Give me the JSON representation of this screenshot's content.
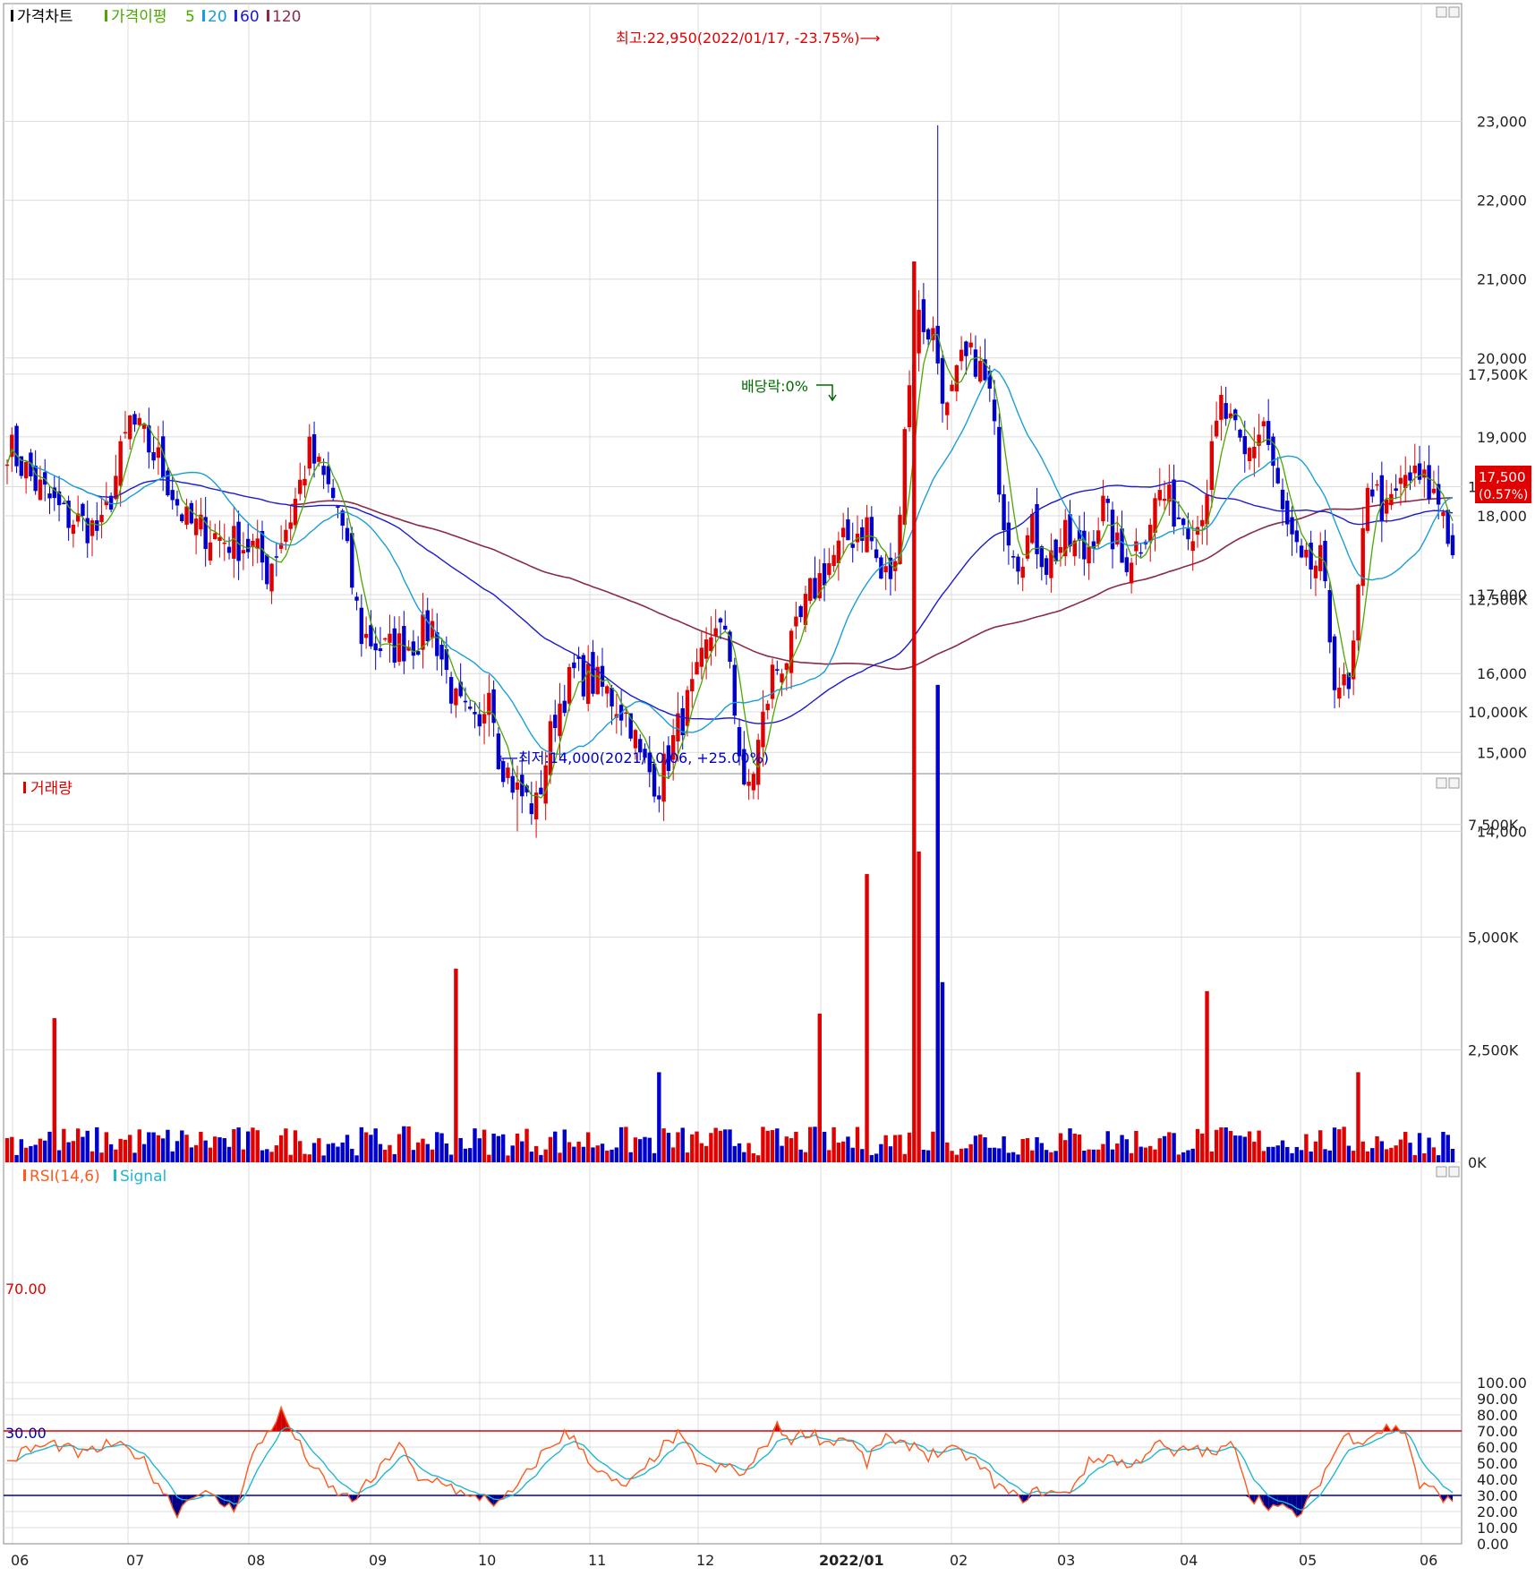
{
  "colors": {
    "up": "#e00000",
    "down": "#0000cc",
    "ma5": "#4aa800",
    "ma20": "#1a9ed8",
    "ma60": "#1a1ad0",
    "ma120": "#8a2a4a",
    "rsi": "#ff5a1e",
    "signal": "#20b8d0",
    "hi": "#e00000",
    "lo": "#00008a",
    "annot_red": "#e00000",
    "annot_blue": "#0000cc",
    "annot_green": "#006a00",
    "price_tag_bg": "#e00000"
  },
  "price_panel": {
    "legend": {
      "title": "가격차트",
      "ma_label": "가격이평",
      "ma5": "5",
      "ma20": "20",
      "ma60": "60",
      "ma120": "120"
    },
    "y_ticks": [
      "23,000",
      "22,000",
      "21,000",
      "20,000",
      "19,000",
      "18,000",
      "17,000",
      "16,000",
      "15,000",
      "14,000"
    ],
    "high_annotation": "최고:22,950(2022/01/17, -23.75%)⟶",
    "low_annotation": "⟵최저:14,000(2021/10/06, +25.00%)",
    "dividend_annotation": "배당락:0%",
    "current_price": "17,500",
    "current_change": "(0.57%)"
  },
  "volume_panel": {
    "legend": "거래량",
    "y_ticks": [
      "17,500K",
      "15,000K",
      "12,500K",
      "10,000K",
      "7,500K",
      "5,000K",
      "2,500K",
      "0K"
    ]
  },
  "rsi_panel": {
    "legend_rsi": "RSI(14,6)",
    "legend_signal": "Signal",
    "y_ticks": [
      "100.00",
      "90.00",
      "80.00",
      "70.00",
      "60.00",
      "50.00",
      "40.00",
      "30.00",
      "20.00",
      "10.00",
      "0.00"
    ],
    "level_high": "70.00",
    "level_low": "30.00"
  },
  "x_axis": {
    "labels": [
      "06",
      "07",
      "08",
      "09",
      "10",
      "11",
      "12",
      "2022/01",
      "02",
      "03",
      "04",
      "05",
      "06"
    ]
  },
  "chart_data": {
    "type": "candlestick",
    "period": "2021-06 to 2022-06 (daily)",
    "price_range": [
      13800,
      23300
    ],
    "high": {
      "value": 22950,
      "date": "2022/01/17",
      "pct": "-23.75%"
    },
    "low": {
      "value": 14000,
      "date": "2021/10/06",
      "pct": "+25.00%"
    },
    "last_close": 17500,
    "last_change_pct": 0.57,
    "close_anchors": [
      [
        0,
        18900
      ],
      [
        6,
        18400
      ],
      [
        12,
        18000
      ],
      [
        20,
        17800
      ],
      [
        26,
        19200
      ],
      [
        32,
        18700
      ],
      [
        38,
        17900
      ],
      [
        46,
        17700
      ],
      [
        52,
        17600
      ],
      [
        55,
        17300
      ],
      [
        60,
        18000
      ],
      [
        64,
        18800
      ],
      [
        70,
        18100
      ],
      [
        75,
        16500
      ],
      [
        80,
        16300
      ],
      [
        86,
        16400
      ],
      [
        90,
        16600
      ],
      [
        95,
        15600
      ],
      [
        100,
        15200
      ],
      [
        102,
        16000
      ],
      [
        104,
        15000
      ],
      [
        108,
        14500
      ],
      [
        112,
        14300
      ],
      [
        116,
        15500
      ],
      [
        120,
        16000
      ],
      [
        124,
        15900
      ],
      [
        128,
        15700
      ],
      [
        132,
        15400
      ],
      [
        134,
        14900
      ],
      [
        138,
        14600
      ],
      [
        142,
        15300
      ],
      [
        146,
        15900
      ],
      [
        150,
        16700
      ],
      [
        153,
        16200
      ],
      [
        156,
        14400
      ],
      [
        158,
        14800
      ],
      [
        162,
        16000
      ],
      [
        166,
        16300
      ],
      [
        170,
        17000
      ],
      [
        174,
        17400
      ],
      [
        178,
        17700
      ],
      [
        182,
        17900
      ],
      [
        185,
        17200
      ],
      [
        188,
        17300
      ],
      [
        190,
        19200
      ],
      [
        193,
        20500
      ],
      [
        196,
        20300
      ],
      [
        199,
        19300
      ],
      [
        202,
        19900
      ],
      [
        205,
        20000
      ],
      [
        208,
        19500
      ],
      [
        211,
        18000
      ],
      [
        214,
        17500
      ],
      [
        217,
        17800
      ],
      [
        220,
        17400
      ],
      [
        224,
        17700
      ],
      [
        228,
        17500
      ],
      [
        232,
        18100
      ],
      [
        236,
        17400
      ],
      [
        240,
        17700
      ],
      [
        244,
        18300
      ],
      [
        248,
        18000
      ],
      [
        252,
        17900
      ],
      [
        254,
        18400
      ],
      [
        257,
        19400
      ],
      [
        262,
        18700
      ],
      [
        266,
        19200
      ],
      [
        270,
        18000
      ],
      [
        274,
        17300
      ],
      [
        278,
        17400
      ],
      [
        281,
        16000
      ],
      [
        284,
        15700
      ],
      [
        286,
        16900
      ],
      [
        288,
        18500
      ],
      [
        292,
        18000
      ],
      [
        296,
        18500
      ],
      [
        300,
        18400
      ],
      [
        304,
        18100
      ],
      [
        306,
        17500
      ]
    ],
    "volume_ticks_k": [
      0,
      2500,
      5000,
      7500,
      10000,
      12500,
      15000,
      17500
    ],
    "volume_spikes": [
      {
        "i": 10,
        "v": 3200
      },
      {
        "i": 95,
        "v": 4300
      },
      {
        "i": 138,
        "v": 2000
      },
      {
        "i": 172,
        "v": 3300
      },
      {
        "i": 182,
        "v": 6400
      },
      {
        "i": 192,
        "v": 20000
      },
      {
        "i": 193,
        "v": 6900
      },
      {
        "i": 197,
        "v": 10600
      },
      {
        "i": 198,
        "v": 4000
      },
      {
        "i": 254,
        "v": 3800
      },
      {
        "i": 286,
        "v": 2000
      }
    ],
    "rsi_levels": [
      30,
      70
    ],
    "rsi_anchors": [
      [
        0,
        50
      ],
      [
        4,
        58
      ],
      [
        10,
        62
      ],
      [
        16,
        55
      ],
      [
        22,
        62
      ],
      [
        28,
        55
      ],
      [
        33,
        33
      ],
      [
        36,
        20
      ],
      [
        40,
        33
      ],
      [
        43,
        29
      ],
      [
        48,
        21
      ],
      [
        52,
        55
      ],
      [
        58,
        82
      ],
      [
        63,
        55
      ],
      [
        68,
        35
      ],
      [
        73,
        27
      ],
      [
        78,
        42
      ],
      [
        83,
        63
      ],
      [
        87,
        38
      ],
      [
        92,
        40
      ],
      [
        98,
        27
      ],
      [
        101,
        30
      ],
      [
        104,
        24
      ],
      [
        108,
        35
      ],
      [
        113,
        55
      ],
      [
        118,
        68
      ],
      [
        121,
        62
      ],
      [
        125,
        45
      ],
      [
        130,
        35
      ],
      [
        134,
        42
      ],
      [
        138,
        58
      ],
      [
        142,
        67
      ],
      [
        145,
        55
      ],
      [
        149,
        45
      ],
      [
        153,
        48
      ],
      [
        156,
        42
      ],
      [
        160,
        60
      ],
      [
        163,
        72
      ],
      [
        166,
        65
      ],
      [
        170,
        70
      ],
      [
        173,
        63
      ],
      [
        178,
        66
      ],
      [
        182,
        50
      ],
      [
        186,
        68
      ],
      [
        188,
        60
      ],
      [
        192,
        62
      ],
      [
        195,
        55
      ],
      [
        199,
        58
      ],
      [
        203,
        55
      ],
      [
        206,
        48
      ],
      [
        210,
        35
      ],
      [
        214,
        28
      ],
      [
        219,
        33
      ],
      [
        224,
        30
      ],
      [
        229,
        50
      ],
      [
        233,
        55
      ],
      [
        238,
        47
      ],
      [
        243,
        63
      ],
      [
        247,
        55
      ],
      [
        251,
        60
      ],
      [
        255,
        55
      ],
      [
        260,
        62
      ],
      [
        263,
        30
      ],
      [
        269,
        22
      ],
      [
        274,
        18
      ],
      [
        278,
        40
      ],
      [
        283,
        67
      ],
      [
        287,
        65
      ],
      [
        292,
        72
      ],
      [
        296,
        70
      ],
      [
        299,
        36
      ],
      [
        303,
        32
      ],
      [
        306,
        24
      ]
    ]
  }
}
